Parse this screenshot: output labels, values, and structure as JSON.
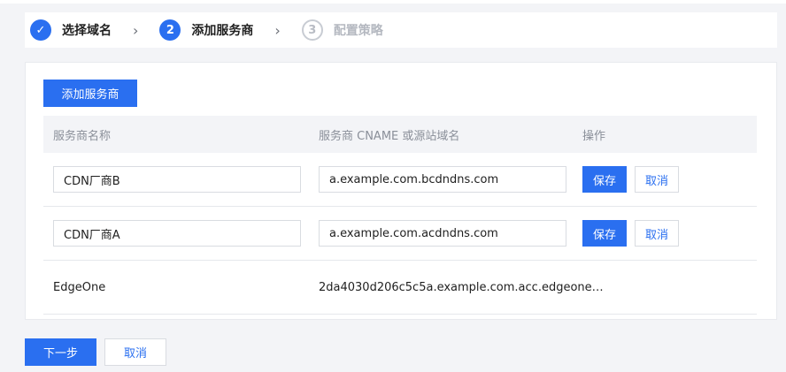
{
  "steps": [
    {
      "number": "✓",
      "label": "选择域名",
      "status": "done"
    },
    {
      "number": "2",
      "label": "添加服务商",
      "status": "active"
    },
    {
      "number": "3",
      "label": "配置策略",
      "status": "pending"
    }
  ],
  "step_separator": "›",
  "card": {
    "add_button": "添加服务商",
    "columns": [
      "服务商名称",
      "服务商 CNAME 或源站域名",
      "操作"
    ],
    "rows": [
      {
        "name": "CDN厂商B",
        "cname": "a.example.com.bcdndns.com",
        "save": "保存",
        "cancel": "取消"
      },
      {
        "name": "CDN厂商A",
        "cname": "a.example.com.acdndns.com",
        "save": "保存",
        "cancel": "取消"
      },
      {
        "name": "EdgeOne",
        "cname": "2da4030d206c5c5a.example.com.acc.edgeone…"
      }
    ]
  },
  "footer": {
    "next": "下一步",
    "cancel": "取消"
  },
  "colors": {
    "primary": "#2a6ff0",
    "background": "#f3f4f7"
  }
}
